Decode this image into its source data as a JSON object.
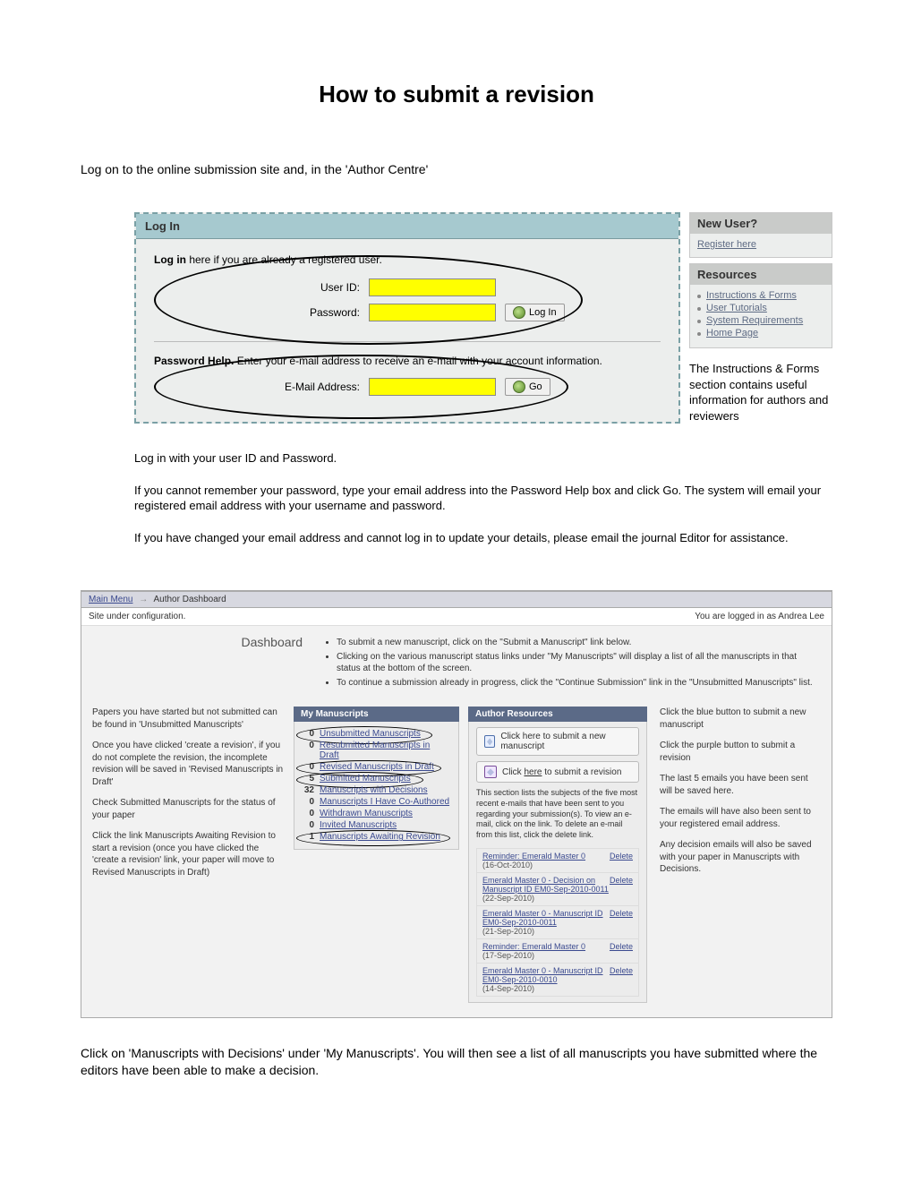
{
  "title": "How to submit a revision",
  "intro": "Log on to the online submission site and, in the 'Author Centre'",
  "login": {
    "header": "Log In",
    "line_bold": "Log in",
    "line_rest": " here if you are already a registered user.",
    "user_label": "User ID:",
    "password_label": "Password:",
    "login_btn": "Log In",
    "help_bold": "Password Help.",
    "help_rest": " Enter your e-mail address to receive an e-mail with your account information.",
    "email_label": "E-Mail Address:",
    "go_btn": "Go"
  },
  "newuser": {
    "header": "New User?",
    "register": "Register here"
  },
  "resources": {
    "header": "Resources",
    "items": [
      "Instructions & Forms",
      "User Tutorials",
      "System Requirements",
      "Home Page"
    ]
  },
  "right_note": "The Instructions & Forms section contains useful information for authors and reviewers",
  "body": {
    "p1": "Log in with your user ID and Password.",
    "p2": "If you cannot remember your password, type your email address into the Password Help box and click Go. The system will email your registered email address with your username and password.",
    "p3": "If you have changed your email address and cannot log in to update your details, please email the journal Editor for assistance."
  },
  "dash": {
    "breadcrumb_main": "Main Menu",
    "breadcrumb_cur": "Author Dashboard",
    "config": "Site under configuration.",
    "logged": "You are logged in as Andrea Lee",
    "heading": "Dashboard",
    "bullets": [
      "To submit a new manuscript, click on the \"Submit a Manuscript\" link below.",
      "Clicking on the various manuscript status links under \"My Manuscripts\" will display a list of all the manuscripts in that status at the bottom of the screen.",
      "To continue a submission already in progress, click the \"Continue Submission\" link in the \"Unsubmitted Manuscripts\" list."
    ]
  },
  "colA": {
    "p1": "Papers you have started but not submitted can be found in 'Unsubmitted Manuscripts'",
    "p2": "Once you have clicked 'create a revision', if you do not complete the revision, the incomplete revision will be saved in 'Revised Manuscripts in Draft'",
    "p3": "Check Submitted Manuscripts for the status of your paper",
    "p4": "Click the link Manuscripts Awaiting Revision to start a revision (once you have clicked the 'create a revision' link, your paper will move to Revised Manuscripts in Draft)"
  },
  "myms": {
    "header": "My Manuscripts",
    "rows": [
      {
        "count": "0",
        "label": "Unsubmitted Manuscripts"
      },
      {
        "count": "0",
        "label": "Resubmitted Manuscripts in Draft"
      },
      {
        "count": "0",
        "label": "Revised Manuscripts in Draft"
      },
      {
        "count": "5",
        "label": "Submitted Manuscripts"
      },
      {
        "count": "32",
        "label": "Manuscripts with Decisions"
      },
      {
        "count": "0",
        "label": "Manuscripts I Have Co-Authored"
      },
      {
        "count": "0",
        "label": "Withdrawn Manuscripts"
      },
      {
        "count": "0",
        "label": "Invited Manuscripts"
      },
      {
        "count": "1",
        "label": "Manuscripts Awaiting Revision"
      }
    ]
  },
  "ares": {
    "header": "Author Resources",
    "btn1": "Click here to submit a new manuscript",
    "btn2_pre": "Click ",
    "btn2_link": "here",
    "btn2_post": " to submit a revision",
    "note": "This section lists the subjects of the five most recent e-mails that have been sent to you regarding your submission(s). To view an e-mail, click on the link. To delete an e-mail from this list, click the delete link.",
    "delete": "Delete",
    "emails": [
      {
        "subj": "Reminder: Emerald Master 0",
        "date": "(16-Oct-2010)"
      },
      {
        "subj": "Emerald Master 0 - Decision on Manuscript ID EM0-Sep-2010-0011",
        "date": "(22-Sep-2010)"
      },
      {
        "subj": "Emerald Master 0 - Manuscript ID EM0-Sep-2010-0011",
        "date": "(21-Sep-2010)"
      },
      {
        "subj": "Reminder: Emerald Master 0",
        "date": "(17-Sep-2010)"
      },
      {
        "subj": "Emerald Master 0 - Manuscript ID EM0-Sep-2010-0010",
        "date": "(14-Sep-2010)"
      }
    ]
  },
  "colD": {
    "p1": "Click the blue button to submit a new manuscript",
    "p2": "Click the purple button to submit a revision",
    "p3": "The last 5 emails you have been sent will be saved here.",
    "p4": "The emails will have also been sent to your registered email address.",
    "p5": "Any decision emails will also be saved with your paper in Manuscripts with Decisions."
  },
  "final": "Click on 'Manuscripts with Decisions' under 'My Manuscripts'. You will then see a list of all manuscripts you have submitted where the editors have been able to make a decision."
}
